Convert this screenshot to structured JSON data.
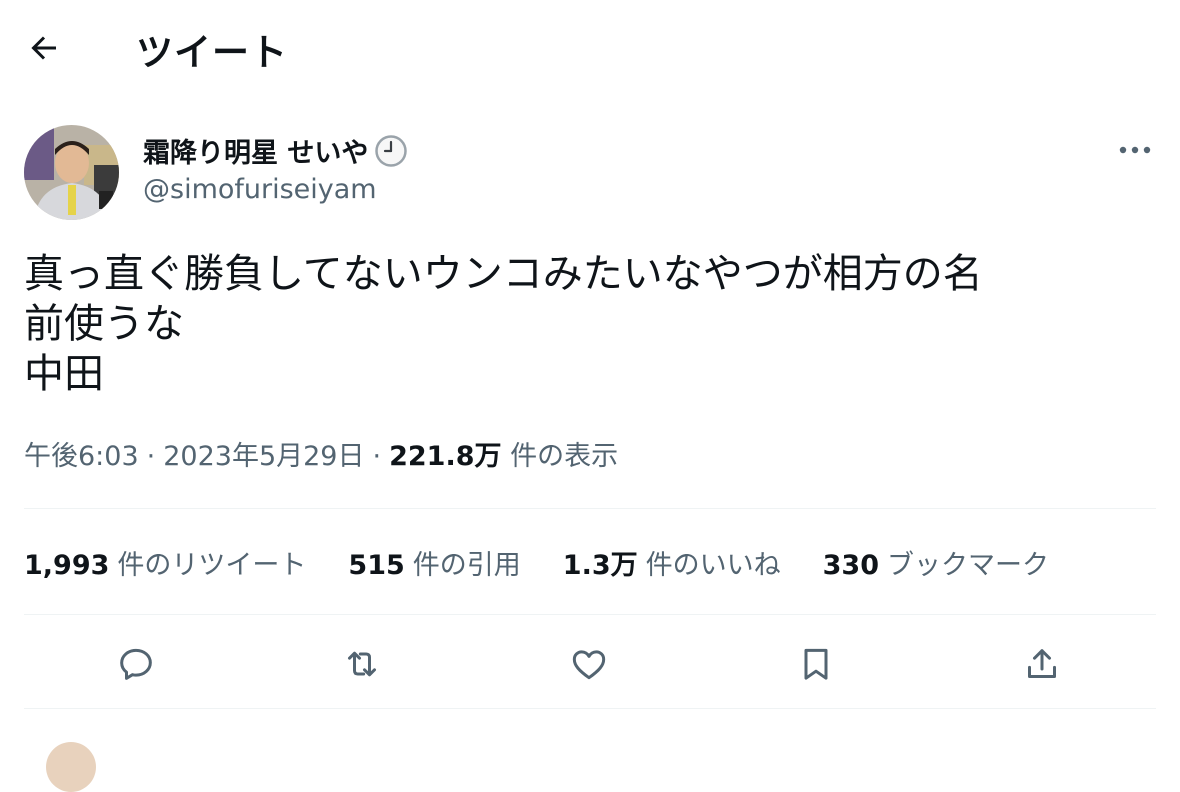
{
  "header": {
    "title": "ツイート"
  },
  "tweet": {
    "display_name": "霜降り明星 せいや",
    "handle": "@simofuriseiyam",
    "text": "真っ直ぐ勝負してないウンコみたいなやつが相方の名\n前使うな\n中田",
    "time": "午後6:03",
    "date": "2023年5月29日",
    "views_count": "221.8万",
    "views_label": "件の表示",
    "separator": "·"
  },
  "stats": [
    {
      "count": "1,993",
      "label": "件のリツイート"
    },
    {
      "count": "515",
      "label": "件の引用"
    },
    {
      "count": "1.3万",
      "label": "件のいいね"
    },
    {
      "count": "330",
      "label": "ブックマーク"
    }
  ],
  "icons": {
    "back": "arrow-left-icon",
    "badge": "clock-icon",
    "more": "more-horizontal-icon",
    "reply": "reply-icon",
    "retweet": "retweet-icon",
    "like": "heart-icon",
    "bookmark": "bookmark-icon",
    "share": "share-icon"
  },
  "colors": {
    "text": "#0f1419",
    "secondary": "#536471",
    "divider": "#eff3f4"
  }
}
